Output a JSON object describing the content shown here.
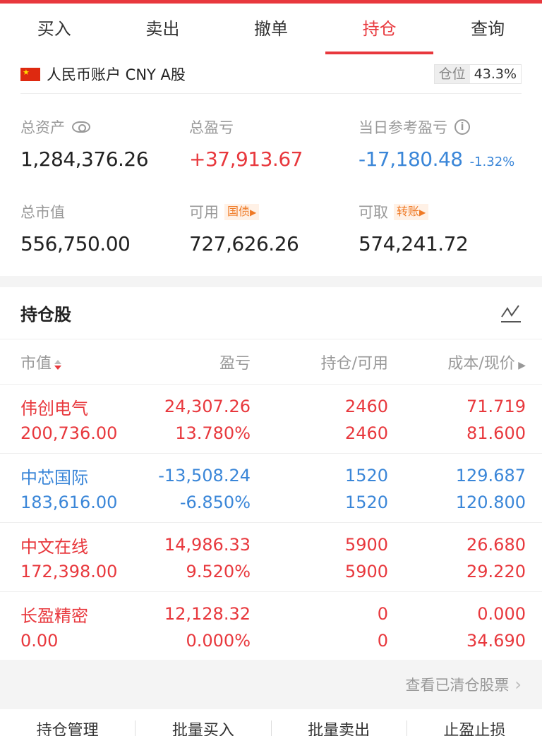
{
  "tabs": [
    "买入",
    "卖出",
    "撤单",
    "持仓",
    "查询"
  ],
  "active_tab": "持仓",
  "account": {
    "name": "人民币账户 CNY A股",
    "position_label": "仓位",
    "position_value": "43.3%"
  },
  "summary": {
    "total_assets_label": "总资产",
    "total_assets": "1,284,376.26",
    "total_pl_label": "总盈亏",
    "total_pl": "+37,913.67",
    "today_pl_label": "当日参考盈亏",
    "today_pl": "-17,180.48",
    "today_pl_pct": "-1.32%",
    "market_value_label": "总市值",
    "market_value": "556,750.00",
    "available_label": "可用",
    "available_tag": "国债",
    "available": "727,626.26",
    "withdrawable_label": "可取",
    "withdrawable_tag": "转账",
    "withdrawable": "574,241.72"
  },
  "holdings": {
    "title": "持仓股",
    "columns": [
      "市值",
      "盈亏",
      "持仓/可用",
      "成本/现价"
    ],
    "rows": [
      {
        "name": "伟创电气",
        "market_value": "200,736.00",
        "pl": "24,307.26",
        "pl_pct": "13.780%",
        "position": "2460",
        "available": "2460",
        "cost": "71.719",
        "price": "81.600",
        "color": "#e8383d"
      },
      {
        "name": "中芯国际",
        "market_value": "183,616.00",
        "pl": "-13,508.24",
        "pl_pct": "-6.850%",
        "position": "1520",
        "available": "1520",
        "cost": "129.687",
        "price": "120.800",
        "color": "#3a86d8"
      },
      {
        "name": "中文在线",
        "market_value": "172,398.00",
        "pl": "14,986.33",
        "pl_pct": "9.520%",
        "position": "5900",
        "available": "5900",
        "cost": "26.680",
        "price": "29.220",
        "color": "#e8383d"
      },
      {
        "name": "长盈精密",
        "market_value": "0.00",
        "pl": "12,128.32",
        "pl_pct": "0.000%",
        "position": "0",
        "available": "0",
        "cost": "0.000",
        "price": "34.690",
        "color": "#e8383d"
      }
    ]
  },
  "cleared_link": "查看已清仓股票",
  "toolbar": [
    "持仓管理",
    "批量买入",
    "批量卖出",
    "止盈止损"
  ],
  "colors": {
    "accent": "#e8383d",
    "down": "#3a86d8",
    "tag": "#ef7a26"
  }
}
